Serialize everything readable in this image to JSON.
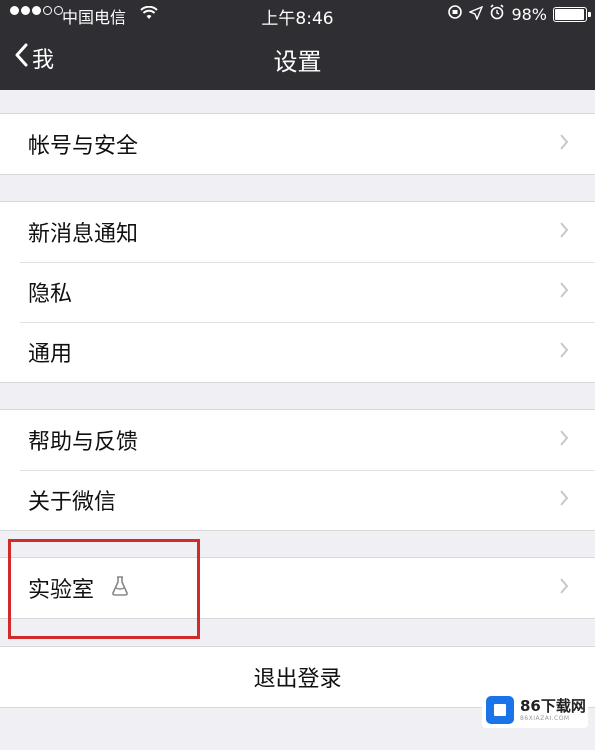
{
  "status": {
    "carrier": "中国电信",
    "time": "上午8:46",
    "battery_text": "98%",
    "battery_level": 0.98
  },
  "nav": {
    "back_label": "我",
    "title": "设置"
  },
  "groups": [
    {
      "items": [
        {
          "label": "帐号与安全"
        }
      ]
    },
    {
      "items": [
        {
          "label": "新消息通知"
        },
        {
          "label": "隐私"
        },
        {
          "label": "通用"
        }
      ]
    },
    {
      "items": [
        {
          "label": "帮助与反馈"
        },
        {
          "label": "关于微信"
        }
      ]
    },
    {
      "items": [
        {
          "label": "实验室",
          "icon": "lab-icon"
        }
      ]
    }
  ],
  "logout_label": "退出登录",
  "watermark": {
    "main": "86下载网",
    "sub": "86XIAZAI.COM"
  },
  "colors": {
    "nav_bg": "#2e2e33",
    "page_bg": "#efeff4",
    "highlight": "#d22a2a"
  }
}
